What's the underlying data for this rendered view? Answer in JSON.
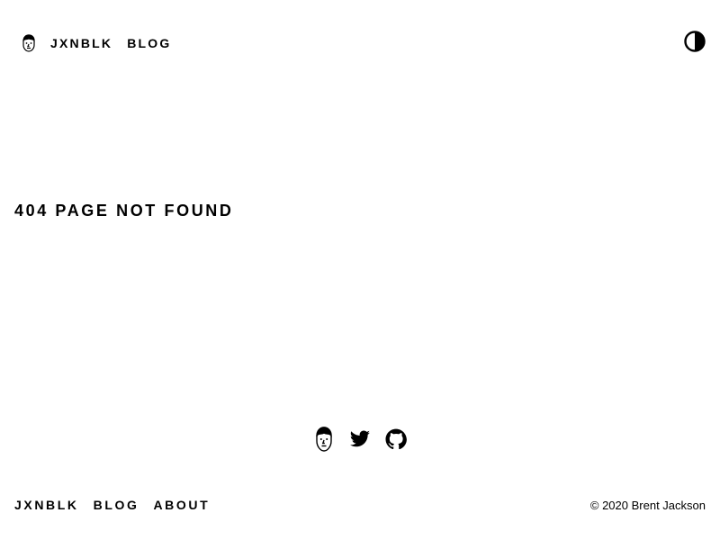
{
  "header": {
    "logo_icon": "face-avatar-icon",
    "brand": "JXNBLK",
    "blog": "BLOG",
    "theme_toggle_icon": "half-circle-contrast-icon"
  },
  "main": {
    "title": "404 PAGE NOT FOUND"
  },
  "footer": {
    "social": [
      {
        "icon": "face-avatar-icon"
      },
      {
        "icon": "twitter-icon"
      },
      {
        "icon": "github-icon"
      }
    ],
    "nav": [
      "JXNBLK",
      "BLOG",
      "ABOUT"
    ],
    "copyright": "© 2020 Brent Jackson"
  }
}
